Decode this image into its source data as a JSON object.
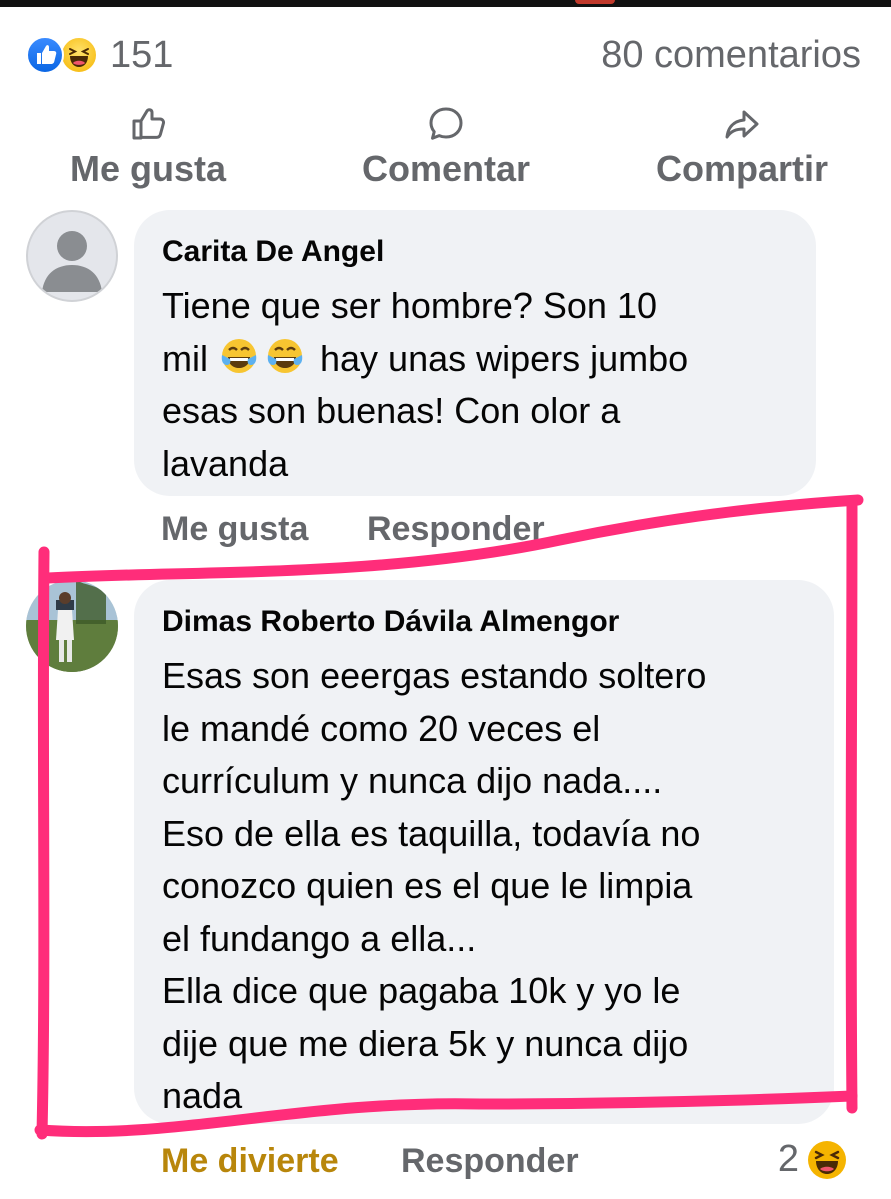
{
  "summary": {
    "reaction_count": "151",
    "comments_count": "80 comentarios",
    "reaction_icons": [
      "like-icon",
      "haha-icon"
    ]
  },
  "actions": {
    "like": "Me gusta",
    "comment": "Comentar",
    "share": "Compartir"
  },
  "comments": [
    {
      "author": "Carita De Angel",
      "lines": [
        "Tiene que ser hombre? Son 10",
        "mil",
        "hay unas wipers jumbo",
        "esas son buenas! Con olor a",
        "lavanda"
      ],
      "like_label": "Me gusta",
      "reply_label": "Responder"
    },
    {
      "author": "Dimas Roberto Dávila Almengor",
      "lines": [
        "Esas son eeergas estando soltero",
        "le mandé como 20 veces el",
        "currículum y nunca dijo nada....",
        "Eso de ella es taquilla, todavía no",
        "conozco quien es el que le limpia",
        "el fundango a ella...",
        "Ella dice que pagaba 10k y yo le",
        "dije que me diera 5k y nunca dijo",
        "nada"
      ],
      "reaction_label": "Me divierte",
      "reply_label": "Responder",
      "reaction_count": "2"
    }
  ],
  "colors": {
    "highlight": "#ff2d7a",
    "like_blue": "#0a66e4",
    "haha_yellow": "#f5b400",
    "muted_text": "#65676b",
    "bubble_bg": "#f0f2f5",
    "reaction_gold": "#b8860b"
  }
}
